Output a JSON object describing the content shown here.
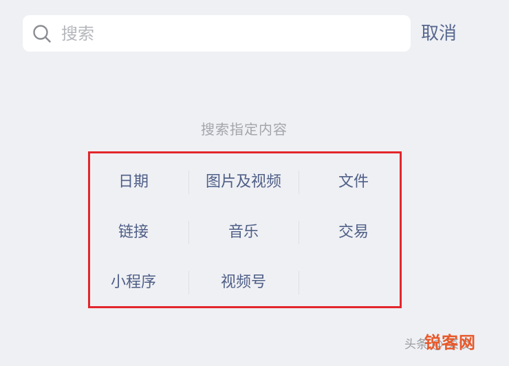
{
  "search": {
    "placeholder": "搜索",
    "cancel_label": "取消"
  },
  "section": {
    "title": "搜索指定内容"
  },
  "categories": [
    [
      "日期",
      "图片及视频",
      "文件"
    ],
    [
      "链接",
      "音乐",
      "交易"
    ],
    [
      "小程序",
      "视频号",
      ""
    ]
  ],
  "watermark": {
    "text": "头条 @ 菜谈",
    "logo": "锐客网"
  },
  "colors": {
    "background": "#eff0f4",
    "link_blue": "#57678f",
    "highlight_red": "#e2262b"
  }
}
